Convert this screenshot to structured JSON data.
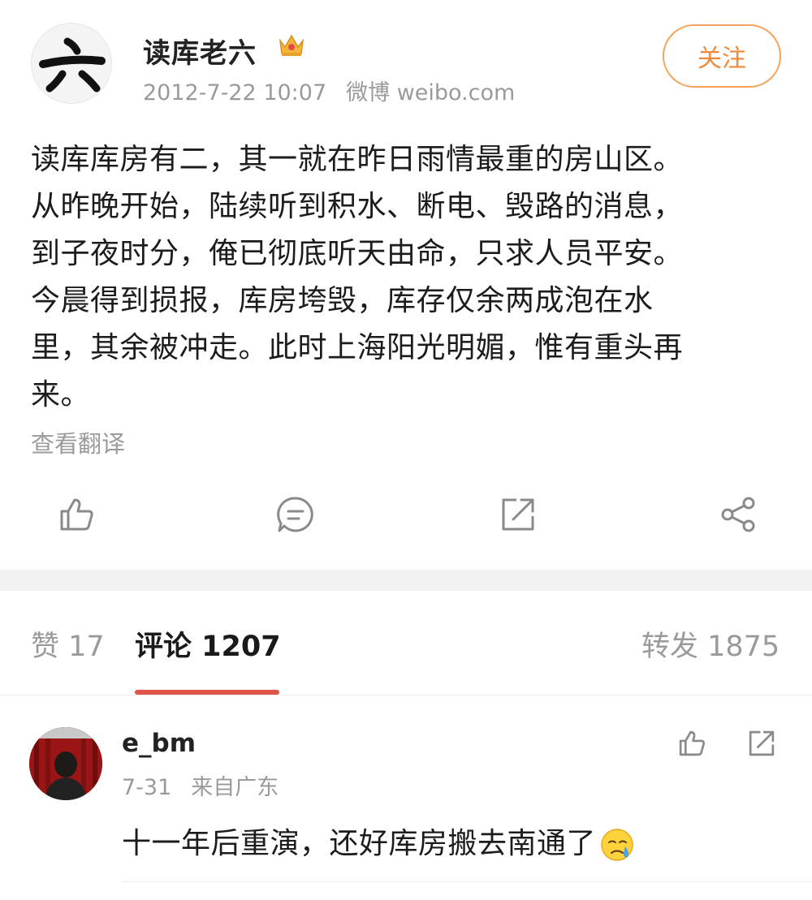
{
  "post": {
    "author": {
      "name": "读库老六",
      "avatar_glyph": "六",
      "badge_icon": "crown-icon"
    },
    "date": "2012-7-22 10:07",
    "source": "微博 weibo.com",
    "follow_label": "关注",
    "text": "读库库房有二，其一就在昨日雨情最重的房山区。\n从昨晚开始，陆续听到积水、断电、毁路的消息，\n到子夜时分，俺已彻底听天由命，只求人员平安。\n今晨得到损报，库房垮毁，库存仅余两成泡在水\n里，其余被冲走。此时上海阳光明媚，惟有重头再\n来。",
    "translate_label": "查看翻译",
    "actions": [
      "thumb-up-icon",
      "comment-icon",
      "repost-icon",
      "share-icon"
    ]
  },
  "tabs": {
    "like": "赞 17",
    "comment": "评论 1207",
    "repost": "转发 1875",
    "active": "comment"
  },
  "comment": {
    "user": "e_bm",
    "date": "7-31",
    "location": "来自广东",
    "text": "十一年后重演，还好库房搬去南通了",
    "emoji_icon": "crying-face-icon"
  },
  "colors": {
    "accent_orange": "#f08a3a",
    "tab_underline": "#e0554a",
    "meta_gray": "#9a9a9a"
  }
}
